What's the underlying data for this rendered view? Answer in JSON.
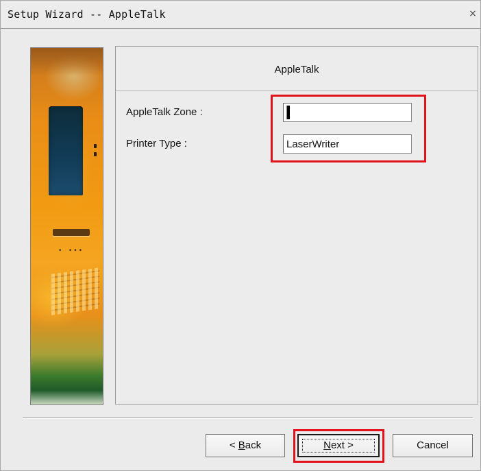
{
  "window": {
    "title": "Setup Wizard -- AppleTalk",
    "close_glyph": "×"
  },
  "panel": {
    "title": "AppleTalk"
  },
  "fields": {
    "zone": {
      "label": "AppleTalk Zone :",
      "value": "*"
    },
    "printer_type": {
      "label": "Printer Type :",
      "value": "LaserWriter"
    }
  },
  "buttons": {
    "back": {
      "prefix": "< ",
      "accel": "B",
      "rest": "ack"
    },
    "next": {
      "accel": "N",
      "rest": "ext >"
    },
    "cancel": {
      "label": "Cancel"
    }
  },
  "colors": {
    "highlight": "#e1121b",
    "window_bg": "#ebebeb"
  },
  "icons": {
    "close": "close-icon"
  }
}
